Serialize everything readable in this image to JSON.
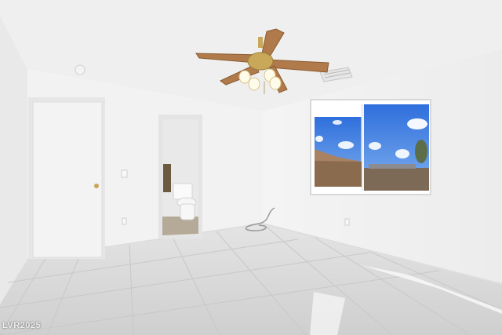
{
  "photo": {
    "subject": "empty-bedroom-interior",
    "watermark": "LVR2025"
  },
  "colors": {
    "ceiling": "#f1f1f1",
    "wall_left": "#ececec",
    "wall_back": "#f3f3f3",
    "wall_right": "#f5f5f5",
    "floor": "#dcdcdc",
    "sky": "#3a7be0",
    "fan_wood": "#b07a4a",
    "fan_brass": "#c9a85a",
    "door": "#f2f2f2"
  }
}
